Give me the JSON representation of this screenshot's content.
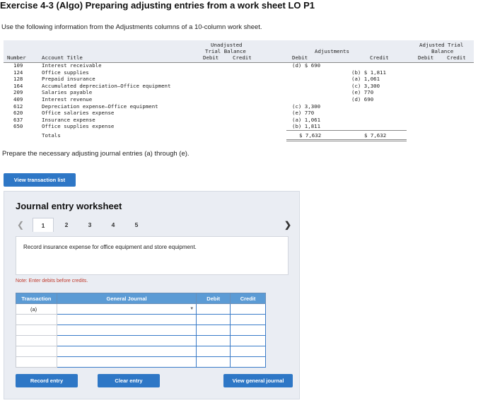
{
  "title": "Exercise 4-3 (Algo) Preparing adjusting entries from a work sheet LO P1",
  "instruction": "Use the following information from the Adjustments columns of a 10-column work sheet.",
  "worksheet": {
    "headers": {
      "number": "Number",
      "account_title": "Account Title",
      "unadjusted_1": "Unadjusted",
      "unadjusted_2": "Trial Balance",
      "debit": "Debit",
      "credit": "Credit",
      "adjustments": "Adjustments",
      "adjusted_1": "Adjusted Trial",
      "adjusted_2": "Balance"
    },
    "rows": [
      {
        "number": "109",
        "title": "Interest receivable",
        "adj_debit": "(d) $ 690",
        "adj_credit": ""
      },
      {
        "number": "124",
        "title": "Office supplies",
        "adj_debit": "",
        "adj_credit": "(b) $ 1,811"
      },
      {
        "number": "128",
        "title": "Prepaid insurance",
        "adj_debit": "",
        "adj_credit": "(a) 1,061"
      },
      {
        "number": "164",
        "title": "Accumulated depreciation—Office equipment",
        "adj_debit": "",
        "adj_credit": "(c) 3,300"
      },
      {
        "number": "209",
        "title": "Salaries payable",
        "adj_debit": "",
        "adj_credit": "(e) 770"
      },
      {
        "number": "409",
        "title": "Interest revenue",
        "adj_debit": "",
        "adj_credit": "(d) 690"
      },
      {
        "number": "612",
        "title": "Depreciation expense—Office equipment",
        "adj_debit": "(c) 3,300",
        "adj_credit": ""
      },
      {
        "number": "620",
        "title": "Office salaries expense",
        "adj_debit": "(e) 770",
        "adj_credit": ""
      },
      {
        "number": "637",
        "title": "Insurance expense",
        "adj_debit": "(a) 1,061",
        "adj_credit": ""
      },
      {
        "number": "650",
        "title": "Office supplies expense",
        "adj_debit": "(b) 1,811",
        "adj_credit": ""
      }
    ],
    "totals_label": "Totals",
    "total_debit": "$ 7,632",
    "total_credit": "$ 7,632"
  },
  "prepare_text": "Prepare the necessary adjusting journal entries (a) through (e).",
  "view_transaction_list": "View transaction list",
  "journal": {
    "heading": "Journal entry worksheet",
    "tabs": [
      "1",
      "2",
      "3",
      "4",
      "5"
    ],
    "active_tab": "1",
    "description": "Record insurance expense for office equipment and store equipment.",
    "note": "Note: Enter debits before credits.",
    "columns": {
      "transaction": "Transaction",
      "general_journal": "General Journal",
      "debit": "Debit",
      "credit": "Credit"
    },
    "rows": [
      {
        "transaction": "(a)",
        "account": "",
        "debit": "",
        "credit": ""
      },
      {
        "transaction": "",
        "account": "",
        "debit": "",
        "credit": ""
      },
      {
        "transaction": "",
        "account": "",
        "debit": "",
        "credit": ""
      },
      {
        "transaction": "",
        "account": "",
        "debit": "",
        "credit": ""
      },
      {
        "transaction": "",
        "account": "",
        "debit": "",
        "credit": ""
      },
      {
        "transaction": "",
        "account": "",
        "debit": "",
        "credit": ""
      }
    ],
    "record_entry": "Record entry",
    "clear_entry": "Clear entry",
    "view_general_journal": "View general journal"
  },
  "icons": {
    "prev": "chevron-left-icon",
    "next": "chevron-right-icon",
    "dropdown": "caret-down-icon"
  },
  "colors": {
    "button_blue": "#2e77c6",
    "header_blue": "#5b9bd5",
    "note_red": "#c0392b",
    "panel_gray": "#eaedf3"
  }
}
